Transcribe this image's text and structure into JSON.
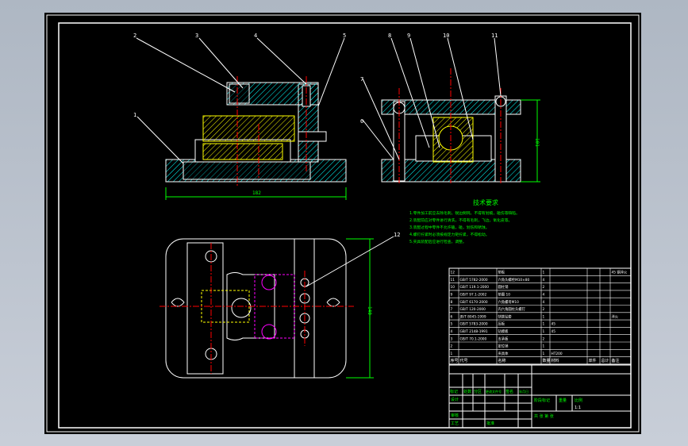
{
  "callouts": {
    "front_view": [
      "1",
      "2",
      "3",
      "4",
      "5"
    ],
    "side_view": [
      "6",
      "7",
      "8",
      "9",
      "10",
      "11"
    ],
    "top_view": [
      "12"
    ]
  },
  "dimensions": {
    "front_width": "182",
    "side_height": "101",
    "top_depth": "140"
  },
  "tech_requirements": {
    "title": "技术要求",
    "lines": [
      "1.零件加工前应去除毛刺，锐边倒钝，不得有划痕，碰伤等缺陷。",
      "2.装配前应对零件进行清洗，不得有毛刺，飞边，氧化皮等。",
      "3.装配过程中零件不允许磕，碰，划伤和锈蚀。",
      "4.螺钉拧紧时必须按规定力矩拧紧，不得松动。",
      "5.夹具装配后应进行检查，调整。"
    ]
  },
  "bom": {
    "rows": [
      {
        "no": "12",
        "code": "",
        "name": "垫板",
        "qty": "1",
        "material": "",
        "note": "45 钢淬火"
      },
      {
        "no": "11",
        "code": "GB/T 5782-2000",
        "name": "六角头螺栓M10×80",
        "qty": "4",
        "material": "",
        "note": ""
      },
      {
        "no": "10",
        "code": "GB/T 119.1-2000",
        "name": "圆柱销",
        "qty": "2",
        "material": "",
        "note": ""
      },
      {
        "no": "9",
        "code": "GB/T 97.1-2002",
        "name": "垫圈 10",
        "qty": "4",
        "material": "",
        "note": ""
      },
      {
        "no": "8",
        "code": "GB/T 6170-2000",
        "name": "六角螺母M10",
        "qty": "4",
        "material": "",
        "note": ""
      },
      {
        "no": "7",
        "code": "GB/T 120-2000",
        "name": "内六角圆柱头螺钉",
        "qty": "2",
        "material": "",
        "note": ""
      },
      {
        "no": "6",
        "code": "JB/T 8045-1999",
        "name": "快换钻套",
        "qty": "1",
        "material": "",
        "note": "淬火"
      },
      {
        "no": "5",
        "code": "GB/T 5783-2000",
        "name": "压板",
        "qty": "1",
        "material": "45",
        "note": ""
      },
      {
        "no": "4",
        "code": "GB/T 2148-1991",
        "name": "钻模板",
        "qty": "1",
        "material": "45",
        "note": ""
      },
      {
        "no": "3",
        "code": "GB/T 70.1-2000",
        "name": "支承板",
        "qty": "2",
        "material": "",
        "note": ""
      },
      {
        "no": "2",
        "code": "",
        "name": "定位销",
        "qty": "1",
        "material": "",
        "note": ""
      },
      {
        "no": "1",
        "code": "",
        "name": "夹具体",
        "qty": "1",
        "material": "HT200",
        "note": ""
      }
    ],
    "header": {
      "no": "序号",
      "code": "代号",
      "name": "名称",
      "qty": "数量",
      "material": "材料",
      "unit": "单件",
      "total": "总计",
      "weight": "重量",
      "note": "备注"
    }
  },
  "title_block": {
    "labels": [
      "标记",
      "处数",
      "分区",
      "更改文件号",
      "签名",
      "年月日",
      "设计",
      "审核",
      "工艺",
      "批准"
    ],
    "stage": "阶段标记",
    "weight": "重量",
    "scale": "比例",
    "scale_value": "1:1",
    "sheet_info": "共 张 第 张"
  },
  "colors": {
    "sheet_bg": "#000000",
    "border": "#ffffff",
    "hatch": "#00ffff",
    "center_line": "#ff0000",
    "dimension": "#00ff00",
    "callout": "#ffffff",
    "workpiece": "#ffff00",
    "hidden": "#ff00ff",
    "text": "#00ff00"
  }
}
